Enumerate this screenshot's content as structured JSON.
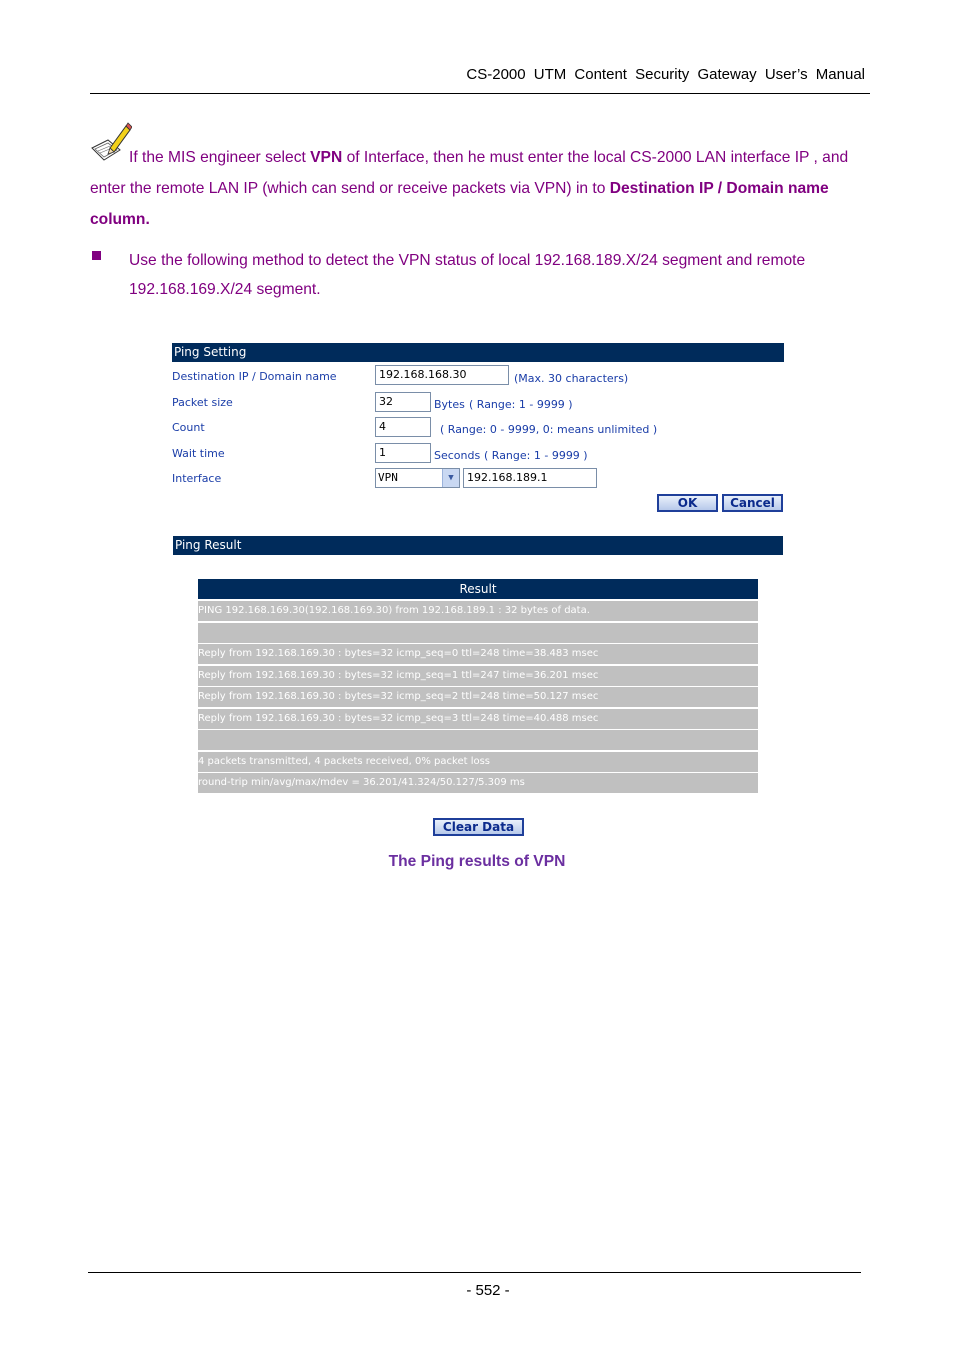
{
  "header": {
    "title": "CS-2000  UTM  Content  Security  Gateway  User’s  Manual"
  },
  "note": {
    "icon": "pencil-note-icon",
    "part1": "If the MIS engineer select ",
    "bold1": "VPN",
    "part2": " of Interface, then he must enter the local CS-2000 LAN interface IP , and enter the remote LAN IP (which can send or receive packets via VPN) in to ",
    "bold2": "Destination IP / Domain name column."
  },
  "bullet": {
    "text": "Use the following method to detect the VPN status of local 192.168.189.X/24 segment and remote 192.168.169.X/24 segment."
  },
  "ping_setting": {
    "title": "Ping Setting",
    "destination": {
      "label": "Destination IP / Domain name",
      "value": "192.168.168.30",
      "hint": "(Max. 30 characters)"
    },
    "packet_size": {
      "label": "Packet size",
      "value": "32",
      "unit": "Bytes",
      "hint": "( Range: 1 - 9999 )"
    },
    "count": {
      "label": "Count",
      "value": "4",
      "hint": "( Range: 0 - 9999, 0: means unlimited )"
    },
    "wait_time": {
      "label": "Wait time",
      "value": "1",
      "unit": "Seconds",
      "hint": "( Range: 1 - 9999 )"
    },
    "interface": {
      "label": "Interface",
      "selected": "VPN",
      "ip": "192.168.189.1"
    },
    "ok_label": "OK",
    "cancel_label": "Cancel"
  },
  "ping_result": {
    "title": "Ping Result",
    "table_header": "Result",
    "rows": [
      "PING  192.168.169.30(192.168.169.30) from 192.168.189.1 :   32 bytes of data.",
      "",
      "Reply from 192.168.169.30 : bytes=32 icmp_seq=0 ttl=248 time=38.483 msec",
      "Reply from 192.168.169.30 : bytes=32 icmp_seq=1 ttl=247 time=36.201 msec",
      "Reply from 192.168.169.30 : bytes=32 icmp_seq=2 ttl=248 time=50.127 msec",
      "Reply from 192.168.169.30 : bytes=32 icmp_seq=3 ttl=248 time=40.488 msec",
      "",
      "4 packets transmitted, 4 packets received, 0% packet loss",
      "round-trip min/avg/max/mdev = 36.201/41.324/50.127/5.309 ms"
    ],
    "clear_label": "Clear Data"
  },
  "caption": "The Ping results of VPN",
  "footer": {
    "page": "- 552 -"
  }
}
